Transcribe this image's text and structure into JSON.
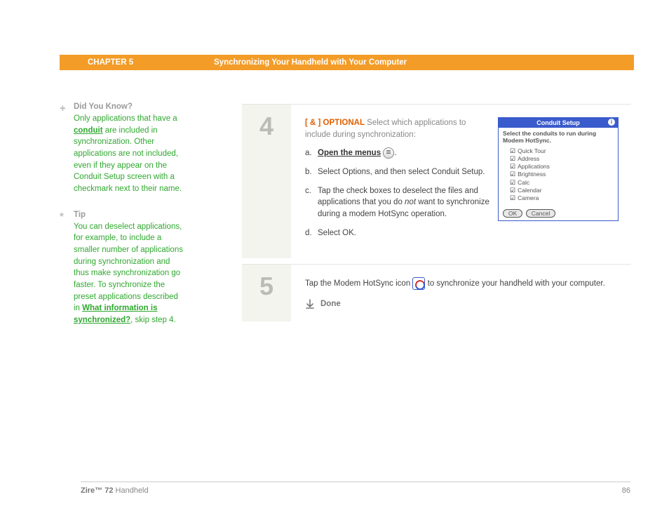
{
  "header": {
    "chapter": "CHAPTER 5",
    "title": "Synchronizing Your Handheld with Your Computer"
  },
  "sidebar": {
    "didyouknow": {
      "title": "Did You Know?",
      "body_pre": "Only applications that have a ",
      "conduit_link": "conduit",
      "body_post": " are included in synchronization. Other applications are not included, even if they appear on the Conduit Setup screen with a checkmark next to their name."
    },
    "tip": {
      "title": "Tip",
      "body_pre": "You can deselect applications, for example, to include a smaller number of applications during synchronization and thus make synchronization go faster. To synchronize the preset applications described in ",
      "link": "What information is synchronized?",
      "body_post": ", skip step 4."
    }
  },
  "steps": {
    "s4": {
      "num": "4",
      "optional_tag": "[ & ]  OPTIONAL",
      "intro": "Select which applications to include during synchronization:",
      "a_label": "a.",
      "a_link": "Open the menus",
      "a_post": ".",
      "b_label": "b.",
      "b_text": "Select Options, and then select Conduit Setup.",
      "c_label": "c.",
      "c_pre": "Tap the check boxes to deselect the files and applications that you do ",
      "c_not": "not",
      "c_post": " want to synchronize during a modem HotSync operation.",
      "d_label": "d.",
      "d_text": "Select OK."
    },
    "s5": {
      "num": "5",
      "pre": "Tap the Modem HotSync icon ",
      "post": " to synchronize your handheld with your computer.",
      "done": "Done"
    }
  },
  "palm": {
    "title": "Conduit Setup",
    "msg": "Select the conduits to run during Modem HotSync.",
    "items": [
      "Quick Tour",
      "Address",
      "Applications",
      "Brightness",
      "Calc",
      "Calendar",
      "Camera"
    ],
    "ok": "OK",
    "cancel": "Cancel"
  },
  "footer": {
    "product_bold": "Zire™ 72",
    "product_rest": " Handheld",
    "page": "86"
  }
}
